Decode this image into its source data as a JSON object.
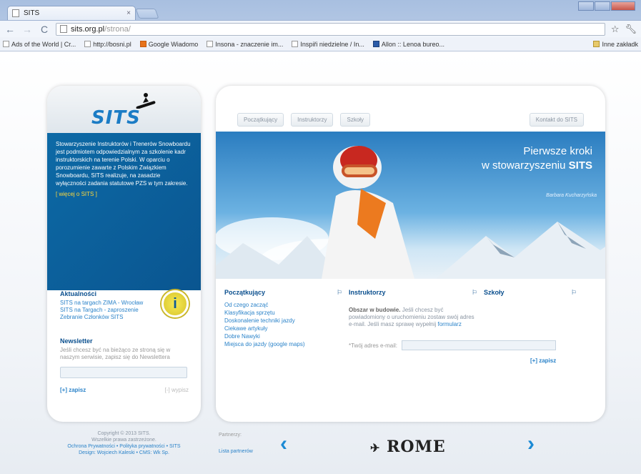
{
  "browser": {
    "tab_title": "SITS",
    "url_host": "sits.org.pl",
    "url_path": "/strona/",
    "bookmarks": [
      "Ads of the World | Cr...",
      "http://bosni.pl",
      "Google Wiadomo",
      "Insona - znaczenie im...",
      "Inspiři niedzielne / In...",
      "Allon :: Lenoa bureo..."
    ],
    "other_bookmarks": "Inne zakładk"
  },
  "sidebar": {
    "logo": "SITS",
    "intro_text": "Stowarzyszenie Instruktorów i Trenerów Snowboardu jest podmiotem odpowiedzialnym za szkolenie kadr instruktorskich na terenie Polski. W oparciu o porozumienie zawarte z Polskim Związkiem Snowboardu, SITS realizuje, na zasadzie wyłączności zadania statutowe PZS w tym zakresie.",
    "intro_more": "[ więcej o SITS ]",
    "info_icon": "i",
    "news_title": "Aktualności",
    "news_items": [
      "SITS na targach ZIMA - Wrocław",
      "SITS na Targach - zaproszenie",
      "Zebranie Członków SITS"
    ],
    "newsletter_title": "Newsletter",
    "newsletter_text": "Jeśli chcesz być na bieżąco ze stroną się w naszym serwisie, zapisz się do Newslettera",
    "newsletter_subscribe": "[+] zapisz",
    "newsletter_unsubscribe": "[-] wypisz"
  },
  "nav": {
    "tabs": [
      "Początkujący",
      "Instruktorzy",
      "Szkoły"
    ],
    "contact": "Kontakt do SITS"
  },
  "hero": {
    "line1": "Pierwsze kroki",
    "line2": "w stowarzyszeniu",
    "line2_bold": "SITS",
    "signature": "Barbara Kucharzyńska"
  },
  "sections": {
    "beginners_title": "Początkujący",
    "beginners_links": [
      "Od czego zacząć",
      "Klasyfikacja sprzętu",
      "Doskonalenie techniki jazdy",
      "Ciekawe artykuły",
      "Dobre Nawyki",
      "Miejsca do jazdy (google maps)"
    ],
    "instructors_title": "Instruktorzy",
    "instructors_desc_bold": "Obszar w budowie.",
    "instructors_desc": "Jeśli chcesz być powiadomiony o uruchomieniu zostaw swój adres e-mail. Jeśli masz sprawę wypełnij",
    "instructors_form_link": "formularz",
    "email_label": "*Twój adres e-mail:",
    "email_value": "",
    "subscribe": "[+] zapisz",
    "schools_title": "Szkoły"
  },
  "footer": {
    "copyright": "Copyright © 2013 SITS.",
    "rights": "Wszelkie prawa zastrzeżone.",
    "links": "Ochrona Prywatności • Polityka prywatności • SITS",
    "design": "Design: Wojciech Kaleski • CMS: Wk Sp.",
    "partners_label": "Partnerzy:",
    "partners_all": "Lista partnerów",
    "sponsor": "ROME"
  }
}
